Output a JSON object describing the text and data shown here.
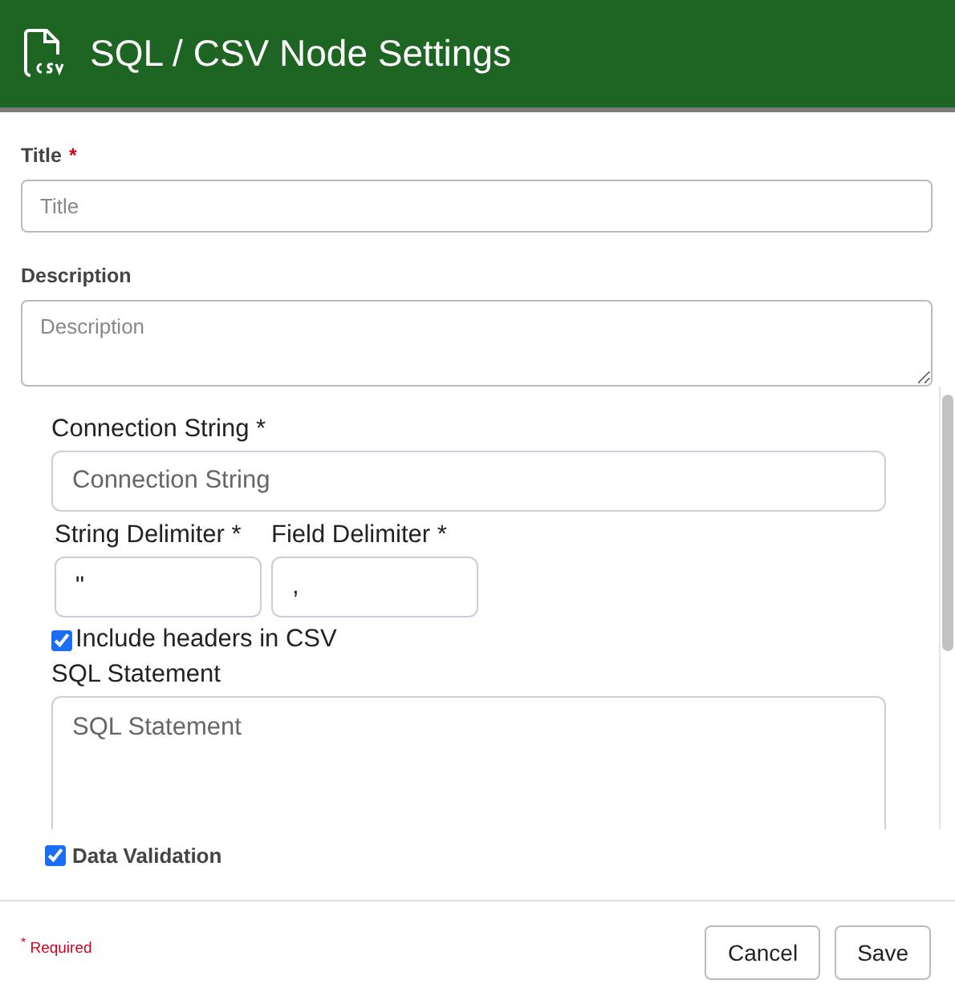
{
  "header": {
    "title": "SQL / CSV Node Settings"
  },
  "title_field": {
    "label": "Title",
    "required_mark": "*",
    "placeholder": "Title"
  },
  "description_field": {
    "label": "Description",
    "placeholder": "Description"
  },
  "settings_panel": {
    "connection_string": {
      "label": "Connection String *",
      "placeholder": "Connection String"
    },
    "string_delimiter": {
      "label": "String Delimiter *",
      "value": "\""
    },
    "field_delimiter": {
      "label": "Field Delimiter *",
      "value": ","
    },
    "include_headers": {
      "label": "Include headers in CSV",
      "checked": true
    },
    "sql_statement": {
      "label": "SQL Statement",
      "placeholder": "SQL Statement"
    }
  },
  "data_validation": {
    "label": "Data Validation",
    "checked": true
  },
  "footer": {
    "required_note": "$^{*}$ Required",
    "buttons": [
      "Cancel",
      "Save"
    ]
  }
}
